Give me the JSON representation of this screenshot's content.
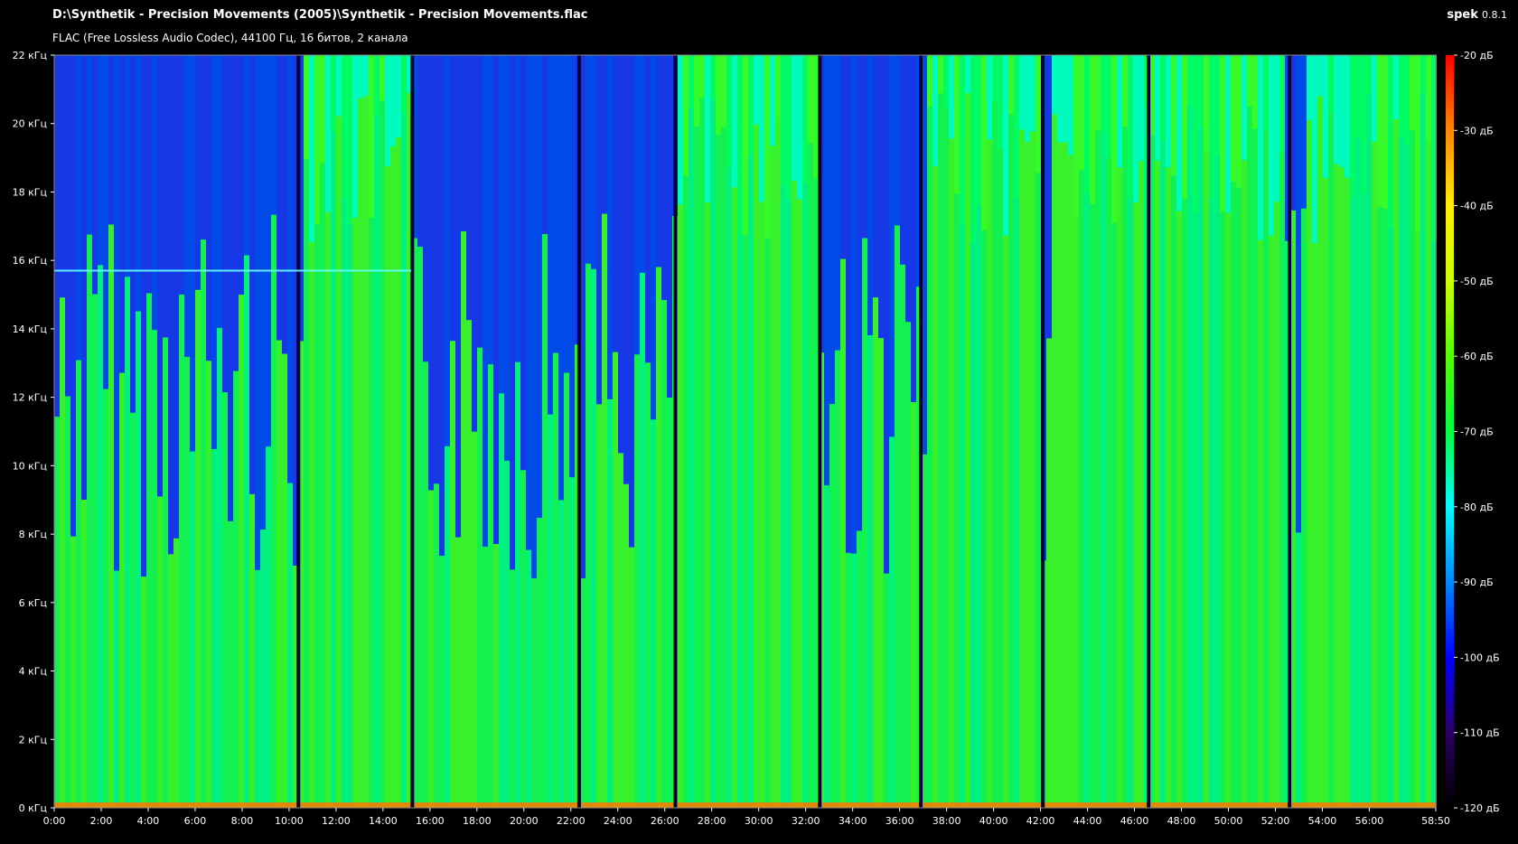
{
  "header": {
    "file_path": "D:\\Synthetik - Precision Movements (2005)\\Synthetik - Precision Movements.flac",
    "format_info": "FLAC (Free Lossless Audio Codec), 44100 Гц, 16 битов, 2 канала",
    "app_name": "spek",
    "app_version": "0.8.1"
  },
  "chart_data": {
    "type": "heatmap",
    "title": "",
    "x_axis": {
      "ticks": [
        "0:00",
        "2:00",
        "4:00",
        "6:00",
        "8:00",
        "10:00",
        "12:00",
        "14:00",
        "16:00",
        "18:00",
        "20:00",
        "22:00",
        "24:00",
        "26:00",
        "28:00",
        "30:00",
        "32:00",
        "34:00",
        "36:00",
        "38:00",
        "40:00",
        "42:00",
        "44:00",
        "46:00",
        "48:00",
        "50:00",
        "52:00",
        "54:00",
        "56:00"
      ],
      "end_label": "58:50",
      "range_minutes": [
        0,
        58.83
      ]
    },
    "y_axis": {
      "ticks": [
        "0 кГц",
        "2 кГц",
        "4 кГц",
        "6 кГц",
        "8 кГц",
        "10 кГц",
        "12 кГц",
        "14 кГц",
        "16 кГц",
        "18 кГц",
        "20 кГц",
        "22 кГц"
      ],
      "range_khz": [
        0,
        22
      ]
    },
    "colorbar": {
      "ticks": [
        "-20 дБ",
        "-30 дБ",
        "-40 дБ",
        "-50 дБ",
        "-60 дБ",
        "-70 дБ",
        "-80 дБ",
        "-90 дБ",
        "-100 дБ",
        "-110 дБ",
        "-120 дБ"
      ],
      "range_db": [
        -120,
        -20
      ],
      "colors": [
        "#000000",
        "#2b0066",
        "#0000ff",
        "#0088ff",
        "#00ffff",
        "#00ff44",
        "#55ff00",
        "#ccff00",
        "#ffee00",
        "#ff8800",
        "#ff0000"
      ]
    },
    "silences_minutes": [
      10.4,
      15.25,
      22.35,
      26.45,
      32.6,
      36.9,
      42.1,
      46.6,
      52.6
    ],
    "quiet_segments_minutes": [
      [
        0.0,
        10.5
      ],
      [
        15.2,
        26.5
      ],
      [
        32.5,
        37.0
      ],
      [
        41.8,
        42.3
      ],
      [
        52.2,
        53.3
      ]
    ],
    "artifact_line": {
      "freq_khz": 15.7,
      "start_min": 0.0,
      "end_min": 15.2
    }
  }
}
